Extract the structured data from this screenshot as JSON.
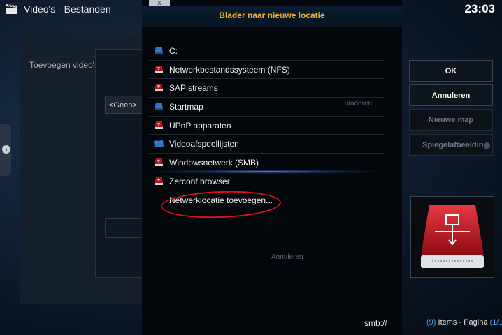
{
  "app": {
    "title": "Video's - Bestanden",
    "clock": "23:03"
  },
  "background_dialog": {
    "title": "Toevoegen video's",
    "content_select": "<Geen>",
    "ghost_browse": "Bladeren",
    "ghost_cancel": "Annuleren"
  },
  "dialog": {
    "title": "Blader naar nieuwe locatie",
    "close_label": "x",
    "items": [
      {
        "label": "C:",
        "icon": "drive-blue"
      },
      {
        "label": "Netwerkbestandssysteem (NFS)",
        "icon": "network-drive-red"
      },
      {
        "label": "SAP streams",
        "icon": "network-drive-red"
      },
      {
        "label": "Startmap",
        "icon": "drive-blue"
      },
      {
        "label": "UPnP apparaten",
        "icon": "network-drive-red"
      },
      {
        "label": "Videoafspeellijsten",
        "icon": "playlist-folder-blue"
      },
      {
        "label": "Windowsnetwerk (SMB)",
        "icon": "network-drive-red"
      },
      {
        "label": "Zerconf browser",
        "icon": "network-drive-red"
      },
      {
        "label": "Netwerklocatie toevoegen...",
        "icon": ""
      }
    ],
    "path": "smb://"
  },
  "buttons": {
    "ok": "OK",
    "cancel": "Annuleren",
    "new_folder": "Nieuwe map",
    "mirror": "Spiegelafbeelding"
  },
  "status": {
    "count": "9",
    "items_label": "Items - Pagina",
    "page": "1/1"
  },
  "colors": {
    "title_accent": "#f1b22a",
    "highlight_ring": "#e0101a",
    "drive_red": "#b4141c",
    "drive_blue": "#2f74c9",
    "count_blue": "#4b9be8"
  }
}
